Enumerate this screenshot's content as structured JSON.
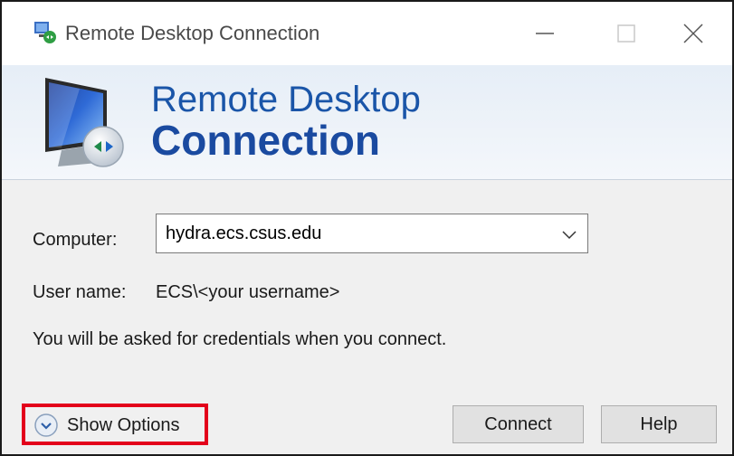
{
  "window": {
    "title": "Remote Desktop Connection",
    "icon": "remote-desktop-app-icon"
  },
  "banner": {
    "line1": "Remote Desktop",
    "line2": "Connection",
    "icon": "monitor-remote-icon"
  },
  "form": {
    "computer_label": "Computer:",
    "computer_value": "hydra.ecs.csus.edu",
    "username_label": "User name:",
    "username_value": "ECS\\<your username>",
    "info": "You will be asked for credentials when you connect."
  },
  "footer": {
    "show_options_label": "Show Options",
    "connect_label": "Connect",
    "help_label": "Help"
  },
  "colors": {
    "highlight": "#e3001b",
    "banner_text": "#1a55a8"
  }
}
